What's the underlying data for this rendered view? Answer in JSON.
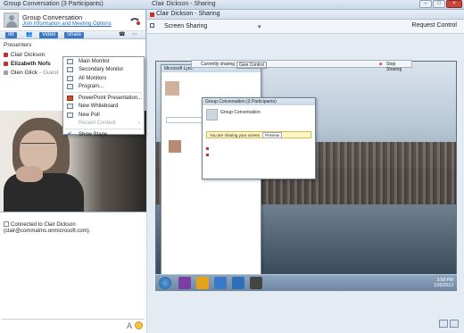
{
  "window": {
    "left_title": "Group Conversation (3 Participants)",
    "right_title": "Clair Dickson - Sharing",
    "controls": [
      "–",
      "□",
      "×"
    ]
  },
  "conversation": {
    "name": "Group Conversation",
    "link": "Join Information and Meeting Options",
    "toolbar": [
      "IM",
      "Video",
      "Share"
    ]
  },
  "presenters": {
    "label": "Presenters",
    "people": [
      {
        "name": "Clair Dickson",
        "color": "#c2322a",
        "bold": false
      },
      {
        "name": "Elizabeth Nofs",
        "color": "#c2322a",
        "bold": true
      },
      {
        "name": "Glen Glick",
        "suffix": "- Guest",
        "color": "#9aa3ad",
        "bold": false
      }
    ]
  },
  "share_menu": {
    "items": [
      {
        "label": "Main Monitor",
        "icon": "monitor-icon"
      },
      {
        "label": "Secondary Monitor",
        "icon": "monitor-icon"
      },
      {
        "label": "All Monitors",
        "icon": "monitors-icon"
      },
      {
        "label": "Program...",
        "icon": "program-icon"
      },
      {
        "label": "PowerPoint Presentation...",
        "icon": "powerpoint-icon"
      },
      {
        "label": "New Whiteboard",
        "icon": "whiteboard-icon"
      },
      {
        "label": "New Poll",
        "icon": "poll-icon"
      },
      {
        "label": "Recent Content",
        "icon": "",
        "disabled": true
      },
      {
        "label": "Show Stage",
        "icon": "check-icon"
      }
    ]
  },
  "chat": {
    "message": "Connected to Clair Dickson",
    "email": "(clair@commalms.onmicrosoft.com)."
  },
  "sharing": {
    "mode": "Screen Sharing",
    "request_control": "Request Control"
  },
  "shared_screen": {
    "bar_left": "Currently sharing",
    "bar_control": "Give Control",
    "bar_stop": "Stop Sharing",
    "lync_title": "Microsoft Lync",
    "conv_title": "Group Conversation (3 Participants)",
    "conv_name": "Group Conversation",
    "sharing_notice": "You are sharing your screen",
    "preview": "Preview",
    "clock_time": "3:58 PM",
    "clock_date": "1/30/2013"
  }
}
